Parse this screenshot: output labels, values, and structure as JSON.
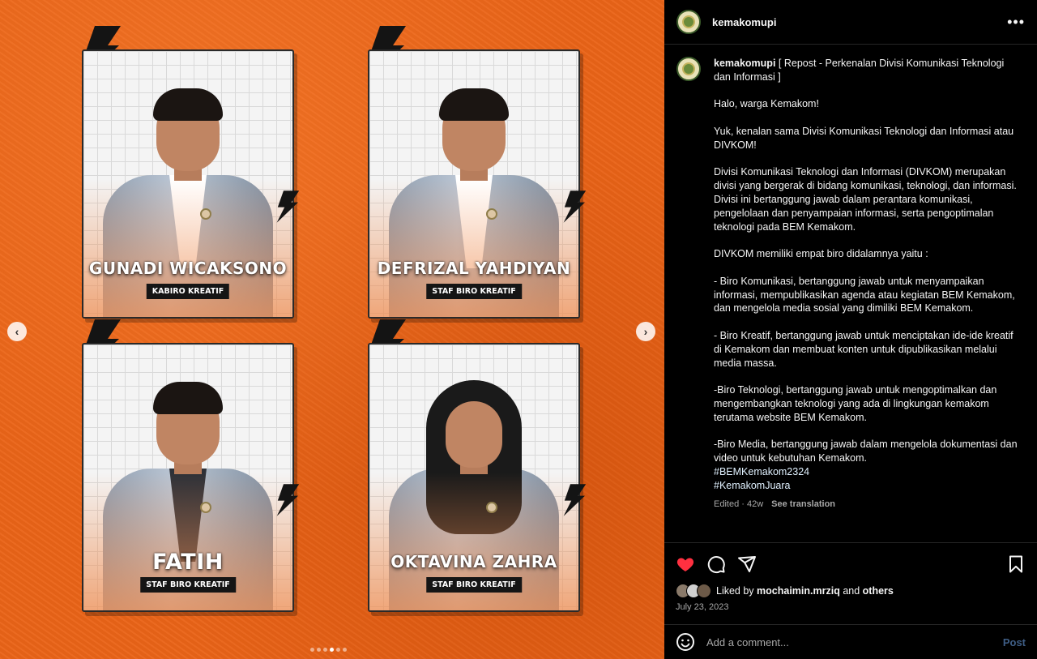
{
  "post": {
    "username": "kemakomupi",
    "more_icon": "more-horizontal-icon",
    "caption_username": "kemakomupi",
    "caption_text": " [ Repost - Perkenalan Divisi Komunikasi Teknologi dan Informasi ]\n\nHalo, warga Kemakom!\n\nYuk, kenalan sama Divisi Komunikasi Teknologi dan Informasi atau DIVKOM!\n\nDivisi Komunikasi Teknologi dan Informasi (DIVKOM) merupakan divisi yang bergerak di bidang komunikasi, teknologi, dan informasi. Divisi ini bertanggung jawab dalam perantara komunikasi, pengelolaan dan penyampaian informasi, serta pengoptimalan teknologi pada BEM Kemakom.\n\nDIVKOM memiliki empat biro didalamnya yaitu :\n\n- Biro Komunikasi, bertanggung jawab untuk menyampaikan informasi, mempublikasikan agenda atau kegiatan BEM Kemakom, dan mengelola media sosial yang dimiliki BEM Kemakom.\n\n- Biro Kreatif, bertanggung jawab untuk menciptakan ide-ide kreatif di Kemakom dan membuat konten untuk dipublikasikan melalui media massa.\n\n-Biro Teknologi, bertanggung jawab untuk mengoptimalkan dan mengembangkan teknologi yang ada di lingkungan kemakom terutama website BEM Kemakom.\n\n-Biro Media, bertanggung jawab dalam mengelola dokumentasi dan video untuk kebutuhan Kemakom.\n",
    "hashtags": [
      "#BEMKemakom2324",
      "#KemakomJuara"
    ],
    "edited": "Edited · 42w",
    "see_translation": "See translation",
    "liked_by_prefix": "Liked by ",
    "liked_by_user": "mochaimin.mrziq",
    "liked_by_and": " and ",
    "liked_by_others": "others",
    "date": "July 23, 2023",
    "comment_placeholder": "Add a comment...",
    "post_label": "Post",
    "liked": true
  },
  "carousel": {
    "prev_label": "‹",
    "next_label": "›",
    "slide_count": 6,
    "active_index": 3,
    "cards": [
      {
        "name": "GUNADI WICAKSONO",
        "role": "KABIRO KREATIF"
      },
      {
        "name": "DEFRIZAL YAHDIYAN",
        "role": "STAF BIRO KREATIF"
      },
      {
        "name": "FATIH",
        "role": "STAF BIRO KREATIF"
      },
      {
        "name": "OKTAVINA ZAHRA",
        "role": "STAF BIRO KREATIF"
      }
    ]
  },
  "colors": {
    "background_orange": "#ea6418",
    "like_red": "#ff3040",
    "post_blue": "#3f5e86"
  }
}
